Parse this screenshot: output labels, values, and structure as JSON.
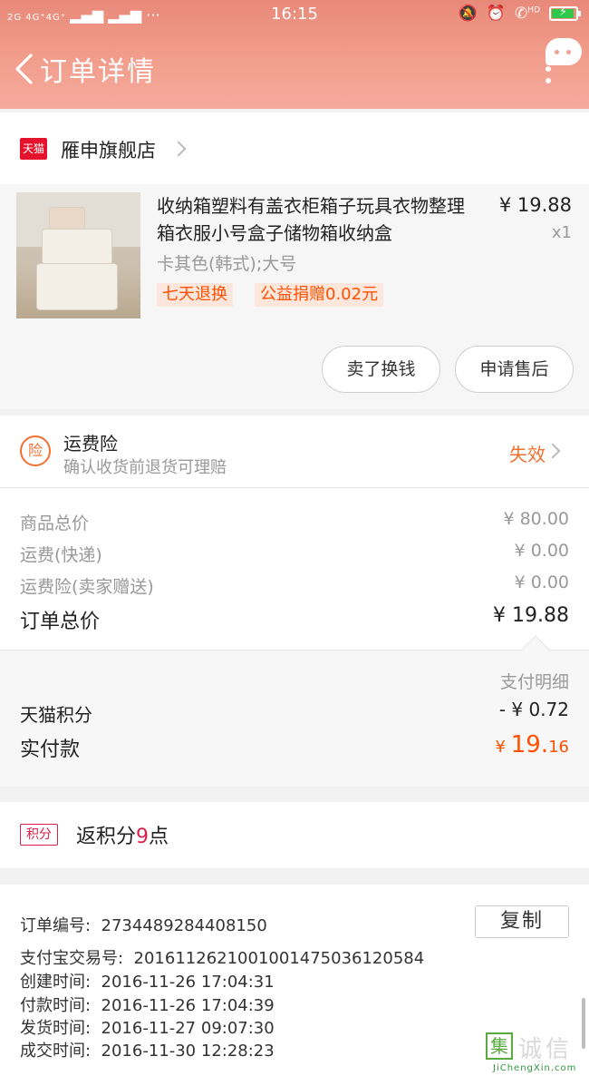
{
  "status_bar": {
    "network": "2G 4G⁺4G⁺",
    "time": "16:15",
    "hd": "HD"
  },
  "header": {
    "title": "订单详情"
  },
  "store": {
    "badge": "天猫",
    "name": "雁申旗舰店"
  },
  "product": {
    "title": "收纳箱塑料有盖衣柜箱子玩具衣物整理箱衣服小号盒子储物箱收纳盒",
    "price": "¥ 19.88",
    "quantity": "x1",
    "sku": "卡其色(韩式);大号",
    "tags": [
      "七天退换",
      "公益捐赠0.02元"
    ]
  },
  "actions": {
    "sell": "卖了换钱",
    "after_sale": "申请售后"
  },
  "insurance": {
    "icon_text": "险",
    "title": "运费险",
    "subtitle": "确认收货前退货可理赔",
    "status": "失效"
  },
  "totals": {
    "rows": [
      {
        "label": "商品总价",
        "value": "¥ 80.00"
      },
      {
        "label": "运费(快递)",
        "value": "¥ 0.00"
      },
      {
        "label": "运费险(卖家赠送)",
        "value": "¥ 0.00"
      }
    ],
    "order_total_label": "订单总价",
    "order_total_value": "¥ 19.88"
  },
  "payment": {
    "detail_label": "支付明细",
    "points_label": "天猫积分",
    "points_value": "- ¥ 0.72",
    "paid_label": "实付款",
    "paid_currency": "¥ ",
    "paid_int": "19.",
    "paid_dec": "16"
  },
  "points": {
    "badge": "积分",
    "prefix": "返积分",
    "count": "9",
    "suffix": "点"
  },
  "order_info": {
    "order_no_label": "订单编号:",
    "order_no": "2734489284408150",
    "copy_label": "复制",
    "alipay_label": "支付宝交易号:",
    "alipay_no": "2016112621001001475036120584",
    "created_label": "创建时间:",
    "created": "2016-11-26  17:04:31",
    "paid_time_label": "付款时间:",
    "paid_time": "2016-11-26  17:04:39",
    "shipped_label": "发货时间:",
    "shipped": "2016-11-27  09:07:30",
    "done_label": "成交时间:",
    "done": "2016-11-30  12:28:23"
  },
  "watermark": {
    "logo": "集",
    "text": "诚信",
    "url": "JiChengXin.com"
  },
  "colors": {
    "accent": "#f07030",
    "price_orange": "#ff5000",
    "tmall_red": "#e4132b",
    "header_pink": "#f19b89"
  }
}
